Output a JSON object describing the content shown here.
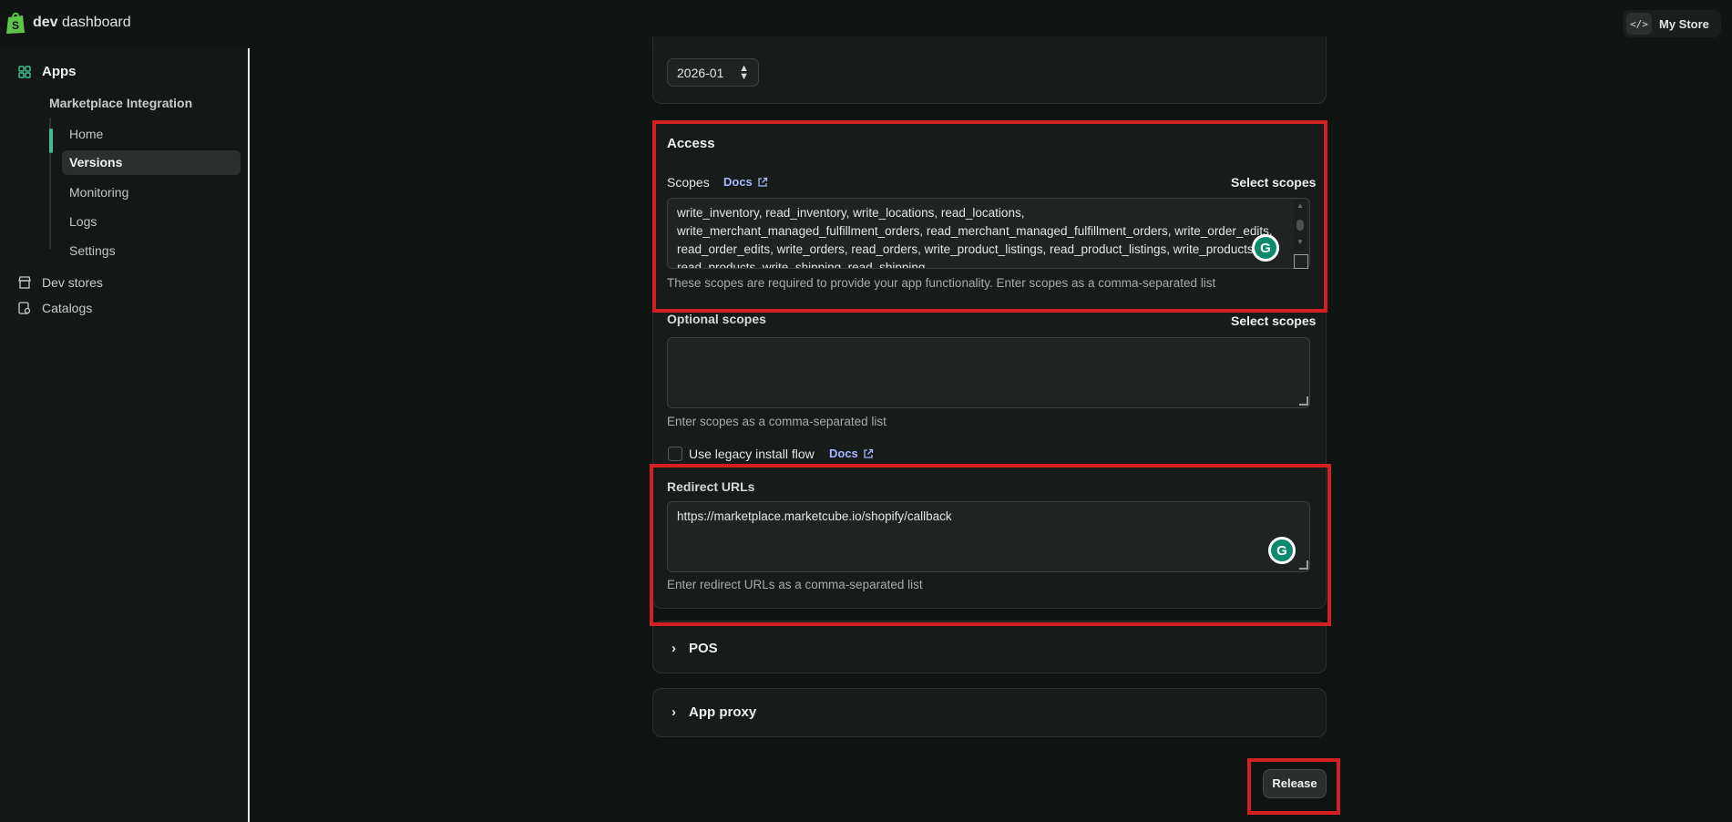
{
  "topbar": {
    "app_title_bold": "dev",
    "app_title_rest": " dashboard",
    "store_code_icon": "</>",
    "store_label": "My Store"
  },
  "sidebar": {
    "apps_label": "Apps",
    "app_name": "Marketplace Integration",
    "items": [
      {
        "label": "Home"
      },
      {
        "label": "Versions",
        "active": true
      },
      {
        "label": "Monitoring"
      },
      {
        "label": "Logs"
      },
      {
        "label": "Settings"
      }
    ],
    "dev_stores_label": "Dev stores",
    "catalogs_label": "Catalogs"
  },
  "main": {
    "api_version": "2026-01",
    "access": {
      "title": "Access",
      "scopes_label": "Scopes",
      "docs_label": "Docs",
      "select_scopes_label": "Select scopes",
      "scopes_value": "write_inventory, read_inventory, write_locations, read_locations, write_merchant_managed_fulfillment_orders, read_merchant_managed_fulfillment_orders, write_order_edits, read_order_edits, write_orders, read_orders, write_product_listings, read_product_listings, write_products, read_products, write_shipping, read_shipping",
      "scopes_help": "These scopes are required to provide your app functionality. Enter scopes as a comma-separated list",
      "optional_label": "Optional scopes",
      "optional_select_label": "Select scopes",
      "optional_value": "",
      "optional_help": "Enter scopes as a comma-separated list",
      "legacy_label": "Use legacy install flow",
      "legacy_docs_label": "Docs",
      "redirect_label": "Redirect URLs",
      "redirect_value": "https://marketplace.marketcube.io/shopify/callback",
      "redirect_help": "Enter redirect URLs as a comma-separated list"
    },
    "pos_label": "POS",
    "app_proxy_label": "App proxy",
    "release_label": "Release"
  },
  "colors": {
    "accent": "#3fbf8f",
    "highlight": "#d42020",
    "link": "#a6b8ff"
  }
}
